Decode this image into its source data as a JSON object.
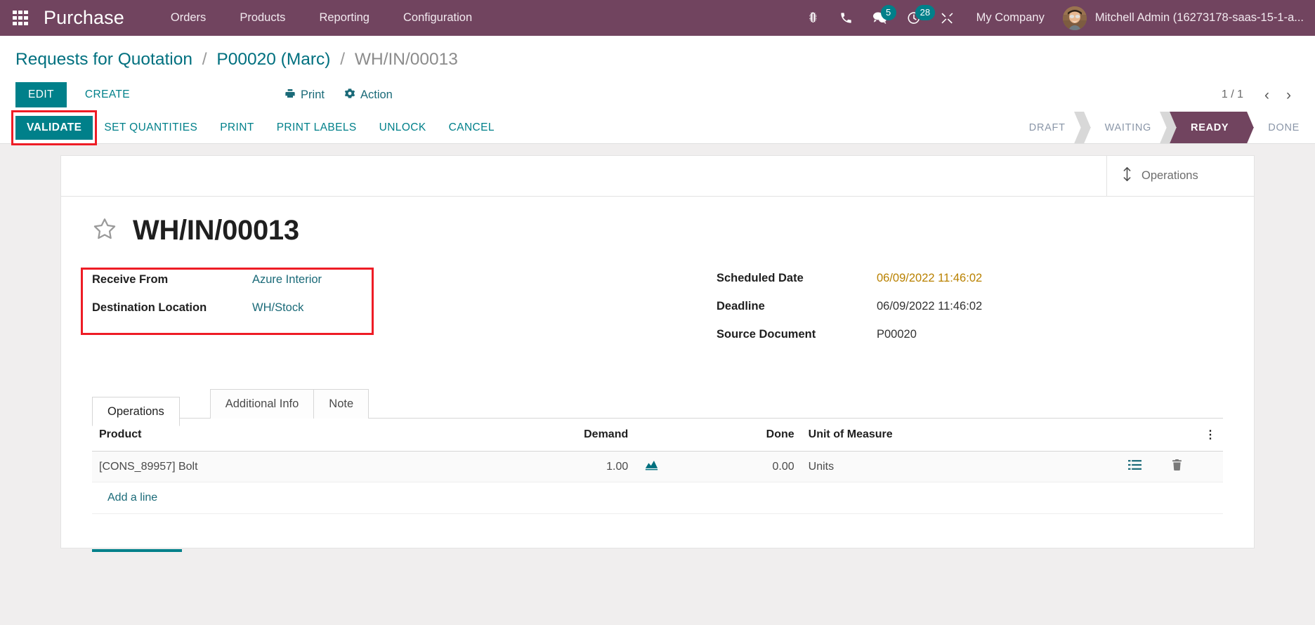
{
  "navbar": {
    "apps_icon": "apps-grid-icon",
    "brand": "Purchase",
    "menu": [
      {
        "label": "Orders"
      },
      {
        "label": "Products"
      },
      {
        "label": "Reporting"
      },
      {
        "label": "Configuration"
      }
    ],
    "sys_icons": [
      {
        "name": "bug-icon",
        "badge": null
      },
      {
        "name": "phone-icon",
        "badge": null
      },
      {
        "name": "messages-icon",
        "badge": "5"
      },
      {
        "name": "activities-clock-icon",
        "badge": "28"
      },
      {
        "name": "tools-icon",
        "badge": null
      }
    ],
    "company": "My Company",
    "user": "Mitchell Admin (16273178-saas-15-1-a..."
  },
  "breadcrumb": {
    "items": [
      {
        "label": "Requests for Quotation",
        "active": false
      },
      {
        "label": "P00020 (Marc)",
        "active": false
      },
      {
        "label": "WH/IN/00013",
        "active": true
      }
    ],
    "separator": "/"
  },
  "control_panel": {
    "edit_label": "EDIT",
    "create_label": "CREATE",
    "print_label": "Print",
    "print_icon": "printer-icon",
    "action_label": "Action",
    "action_icon": "gear-icon",
    "pager_count": "1 / 1",
    "prev_icon": "chevron-left-icon",
    "next_icon": "chevron-right-icon"
  },
  "action_bar": {
    "buttons": [
      {
        "label": "VALIDATE",
        "primary": true,
        "highlighted": true
      },
      {
        "label": "SET QUANTITIES",
        "primary": false,
        "highlighted": false
      },
      {
        "label": "PRINT",
        "primary": false,
        "highlighted": false
      },
      {
        "label": "PRINT LABELS",
        "primary": false,
        "highlighted": false
      },
      {
        "label": "UNLOCK",
        "primary": false,
        "highlighted": false
      },
      {
        "label": "CANCEL",
        "primary": false,
        "highlighted": false
      }
    ],
    "statuses": [
      {
        "label": "DRAFT",
        "active": false
      },
      {
        "label": "WAITING",
        "active": false
      },
      {
        "label": "READY",
        "active": true
      },
      {
        "label": "DONE",
        "active": false
      }
    ]
  },
  "sheet": {
    "stat_button": {
      "label": "Operations",
      "icon": "arrows-vertical-icon"
    },
    "star_icon": "star-outline-icon",
    "title": "WH/IN/00013",
    "left_fields": [
      {
        "label": "Receive From",
        "value": "Azure Interior",
        "style": "link"
      },
      {
        "label": "Destination Location",
        "value": "WH/Stock",
        "style": "link"
      }
    ],
    "right_fields": [
      {
        "label": "Scheduled Date",
        "value": "06/09/2022 11:46:02",
        "style": "warn"
      },
      {
        "label": "Deadline",
        "value": "06/09/2022 11:46:02",
        "style": "plain"
      },
      {
        "label": "Source Document",
        "value": "P00020",
        "style": "plain"
      }
    ]
  },
  "notebook": {
    "tabs": [
      {
        "label": "Operations",
        "active": true,
        "highlighted": true
      },
      {
        "label": "Additional Info",
        "active": false,
        "highlighted": false
      },
      {
        "label": "Note",
        "active": false,
        "highlighted": false
      }
    ],
    "table": {
      "columns": [
        "Product",
        "Demand",
        "Done",
        "Unit of Measure"
      ],
      "optional_col_icon": "column-options-icon",
      "rows": [
        {
          "product": "[CONS_89957] Bolt",
          "demand": "1.00",
          "forecast_icon": "forecast-report-icon",
          "done": "0.00",
          "uom": "Units",
          "detail_icon": "detailed-operations-icon",
          "delete_icon": "trash-icon"
        }
      ],
      "add_line_label": "Add a line"
    }
  },
  "colors": {
    "navbar_bg": "#71445f",
    "accent_teal": "#00808a",
    "link_teal": "#1a6a78",
    "warn_orange": "#b98100",
    "highlight_red": "#ee1c25",
    "badge_bg": "#00808a"
  }
}
